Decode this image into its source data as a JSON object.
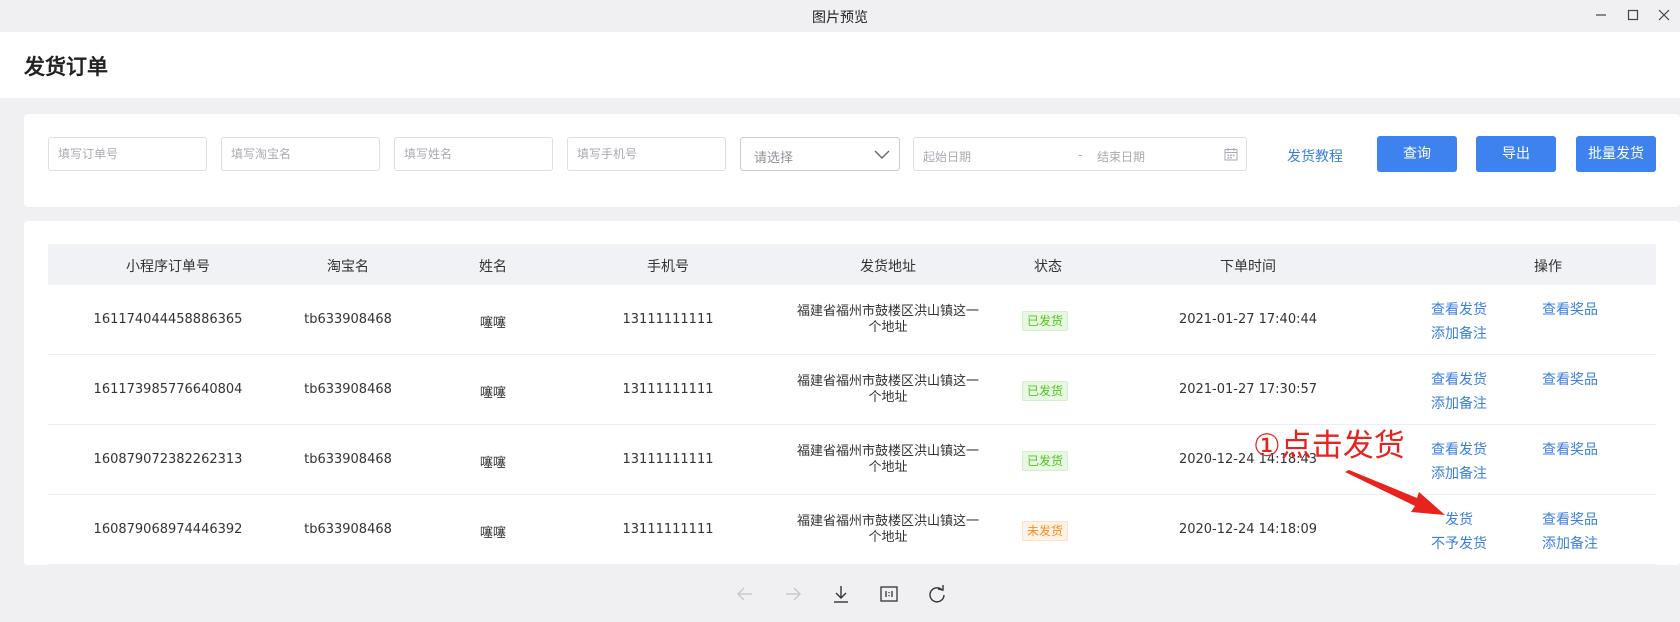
{
  "window": {
    "title": "图片预览"
  },
  "page": {
    "title": "发货订单"
  },
  "filters": {
    "order_no_placeholder": "填写订单号",
    "taobao_placeholder": "填写淘宝名",
    "name_placeholder": "填写姓名",
    "phone_placeholder": "填写手机号",
    "select_value": "请选择",
    "start_date_placeholder": "起始日期",
    "date_sep": "-",
    "end_date_placeholder": "结束日期",
    "tutorial_link": "发货教程",
    "query_button": "查询",
    "export_button": "导出",
    "batch_ship_button": "批量发货"
  },
  "table": {
    "headers": [
      "小程序订单号",
      "淘宝名",
      "姓名",
      "手机号",
      "发货地址",
      "状态",
      "下单时间",
      "操作"
    ],
    "rows": [
      {
        "order_no": "161174044458886365",
        "taobao": "tb633908468",
        "name": "噻噻",
        "phone": "13111111111",
        "addr1": "福建省福州市鼓楼区洪山镇这一",
        "addr2": "个地址",
        "status": "已发货",
        "time": "2021-01-27 17:40:44",
        "op1": "查看发货",
        "op2": "查看奖品",
        "op3": "添加备注",
        "op4": ""
      },
      {
        "order_no": "161173985776640804",
        "taobao": "tb633908468",
        "name": "噻噻",
        "phone": "13111111111",
        "addr1": "福建省福州市鼓楼区洪山镇这一",
        "addr2": "个地址",
        "status": "已发货",
        "time": "2021-01-27 17:30:57",
        "op1": "查看发货",
        "op2": "查看奖品",
        "op3": "添加备注",
        "op4": ""
      },
      {
        "order_no": "160879072382262313",
        "taobao": "tb633908468",
        "name": "噻噻",
        "phone": "13111111111",
        "addr1": "福建省福州市鼓楼区洪山镇这一",
        "addr2": "个地址",
        "status": "已发货",
        "time": "2020-12-24 14:18:43",
        "op1": "查看发货",
        "op2": "查看奖品",
        "op3": "添加备注",
        "op4": ""
      },
      {
        "order_no": "160879068974446392",
        "taobao": "tb633908468",
        "name": "噻噻",
        "phone": "13111111111",
        "addr1": "福建省福州市鼓楼区洪山镇这一",
        "addr2": "个地址",
        "status": "未发货",
        "time": "2020-12-24 14:18:09",
        "op1": "发货",
        "op2": "查看奖品",
        "op3": "不予发货",
        "op4": "添加备注"
      }
    ]
  },
  "annotation": {
    "text": "①点击发货",
    "color": "#e8231e"
  },
  "colors": {
    "primary": "#3d82ee",
    "link": "#3a7fe0",
    "shipped": "#52c41a",
    "unshipped": "#fa8c16"
  },
  "toolbar": {
    "icons": [
      "arrow-left-icon",
      "arrow-right-icon",
      "download-icon",
      "actual-size-icon",
      "rotate-icon"
    ]
  }
}
